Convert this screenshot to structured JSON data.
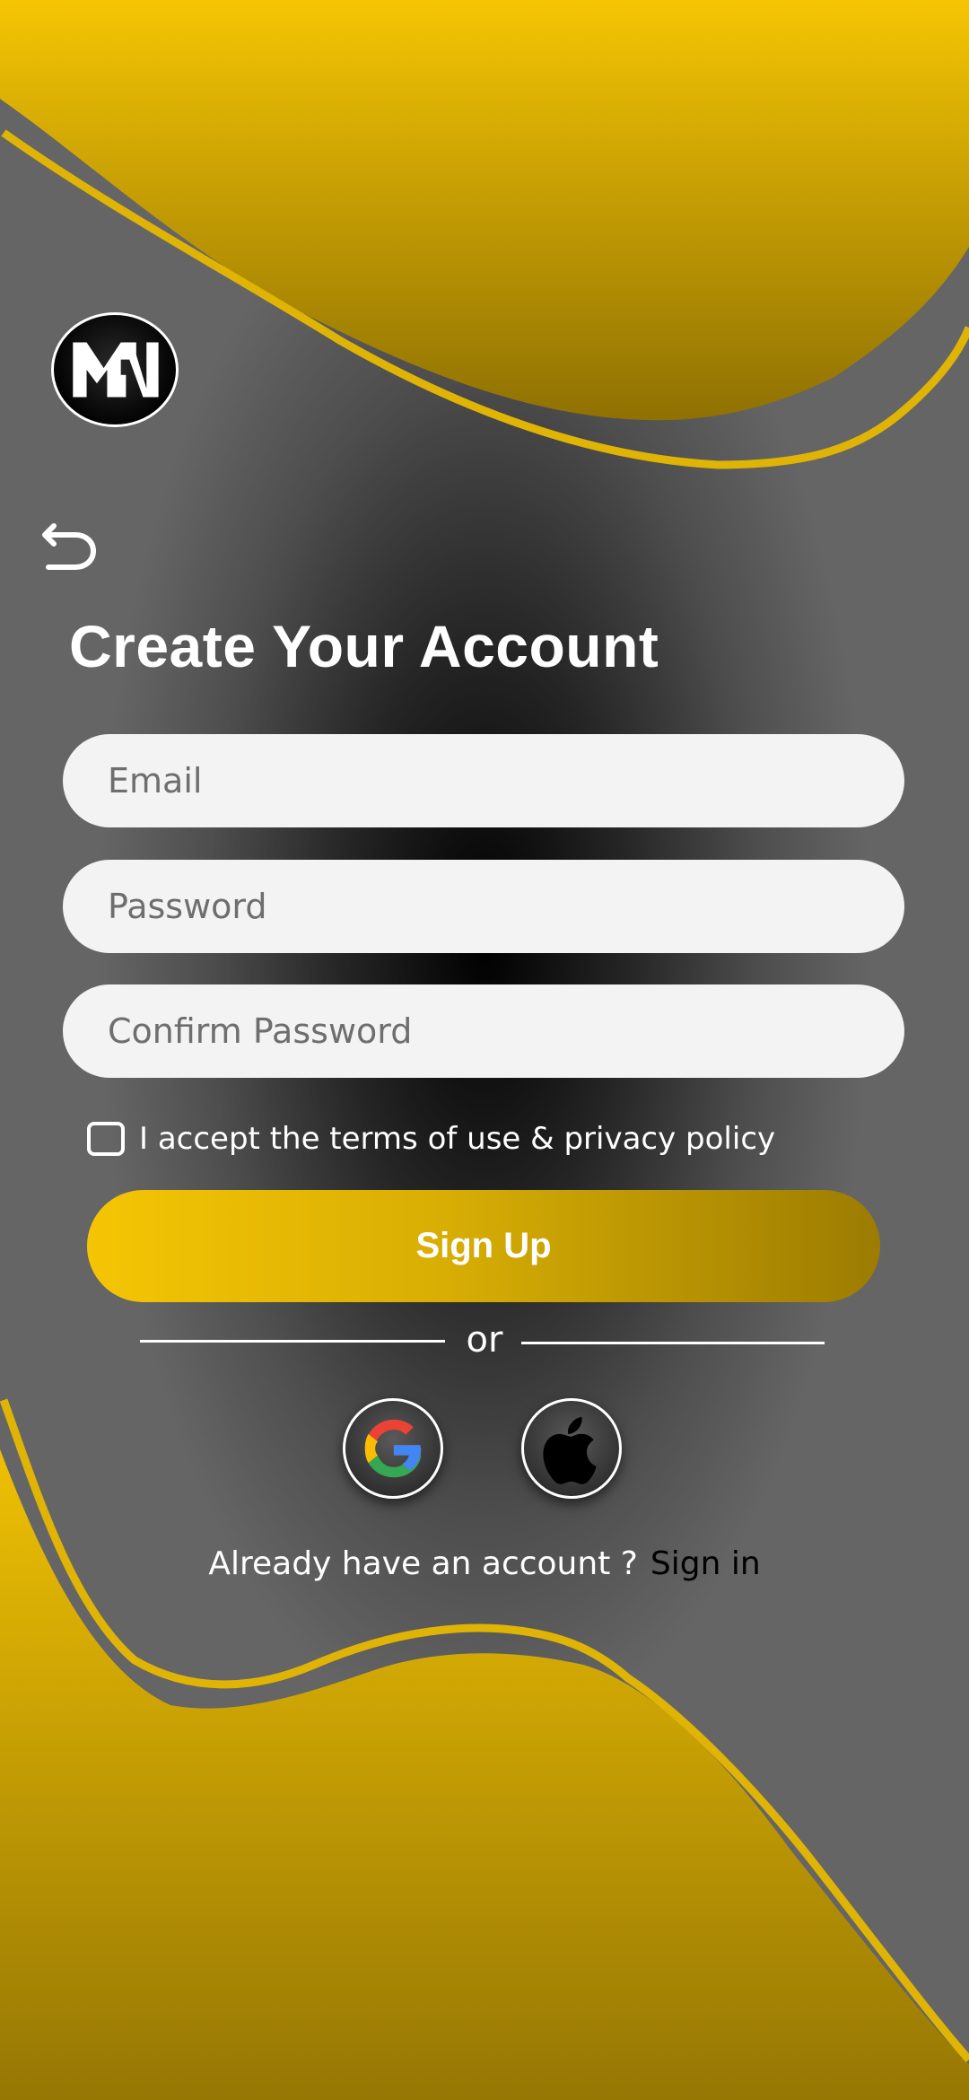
{
  "header": {
    "logo_icon": "mn-monogram-logo",
    "back_icon": "back-arrow-icon"
  },
  "form": {
    "title": "Create Your Account",
    "email_placeholder": "Email",
    "password_placeholder": "Password",
    "confirm_placeholder": "Confirm Password",
    "terms_label": "I accept the terms of use & privacy policy",
    "terms_checked": false,
    "submit_label": "Sign Up"
  },
  "divider": {
    "text": "or"
  },
  "social": {
    "google_icon": "google-icon",
    "apple_icon": "apple-icon"
  },
  "footer": {
    "prompt": "Already have an account ?",
    "link": "Sign in"
  },
  "colors": {
    "accent_gold": "#f5c504",
    "accent_gold_dark": "#9c7c02",
    "field_bg": "#f3f3f3",
    "background_gray": "#646464"
  }
}
